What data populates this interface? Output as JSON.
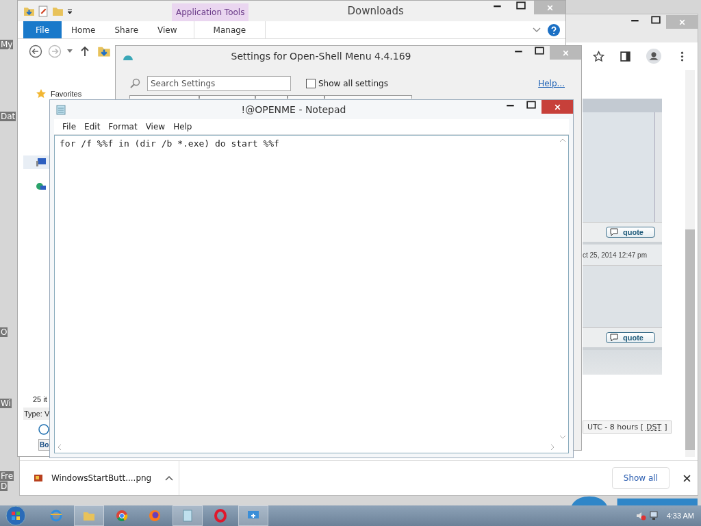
{
  "desktop": {
    "icon_labels": [
      "My",
      "Dat",
      "O",
      "Wi",
      "Fre",
      "D"
    ]
  },
  "browser": {
    "page": {
      "quote_buttons": [
        "quote",
        "quote"
      ],
      "post_date": "ct 25, 2014 12:47 pm",
      "timezone": {
        "prefix": "UTC - 8 hours [",
        "abbr": "DST",
        "suffix": "]"
      }
    },
    "downloads_bar": {
      "file": "WindowsStartButt....png",
      "show_all": "Show all"
    }
  },
  "explorer": {
    "title": "Downloads",
    "context_group": "Application Tools",
    "file_tab": "File",
    "tabs": [
      "Home",
      "Share",
      "View",
      "Manage"
    ],
    "favorites": "Favorites",
    "status": "25 it",
    "type_label": "Type: V",
    "bottom_button": "Bo"
  },
  "settings": {
    "title": "Settings for Open-Shell Menu 4.4.169",
    "search_placeholder": "Search Settings",
    "show_all": {
      "label": "Show all settings",
      "checked": false
    },
    "help": "Help..."
  },
  "notepad": {
    "title": "!@OPENME - Notepad",
    "menu": [
      "File",
      "Edit",
      "Format",
      "View",
      "Help"
    ],
    "text": "for /f %%f in (dir /b *.exe) do start %%f"
  },
  "taskbar": {
    "clock": "4:33 AM"
  }
}
